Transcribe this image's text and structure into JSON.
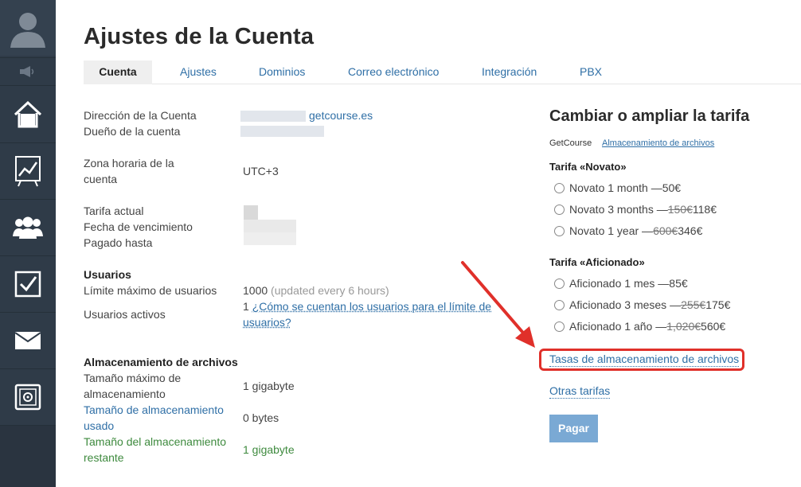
{
  "sidebar": {
    "items": [
      {
        "icon": "home-icon"
      },
      {
        "icon": "chart-icon"
      },
      {
        "icon": "users-icon"
      },
      {
        "icon": "checkbox-icon"
      },
      {
        "icon": "mail-icon"
      },
      {
        "icon": "safe-icon"
      }
    ]
  },
  "header": {
    "title": "Ajustes de la Cuenta",
    "tabs": [
      "Cuenta",
      "Ajustes",
      "Dominios",
      "Correo electrónico",
      "Integración",
      "PBX"
    ]
  },
  "account": {
    "address_label": "Dirección de la Cuenta",
    "address_domain": "getcourse.es",
    "owner_label": "Dueño de la cuenta",
    "timezone_label_1": "Zona horaria de la",
    "timezone_label_2": "cuenta",
    "timezone_value": "UTC+3",
    "tariff_label": "Tarifa actual",
    "expiry_label": "Fecha de vencimiento",
    "paid_label": "Pagado hasta"
  },
  "users": {
    "heading": "Usuarios",
    "max_label": "Límite máximo de usuarios",
    "max_value": "1000",
    "max_note": "(updated every 6 hours)",
    "active_label": "Usuarios activos",
    "active_value": "1",
    "active_link_1": "¿Cómo se cuentan los usuarios para el límite de",
    "active_link_2": "usuarios?"
  },
  "storage": {
    "heading": "Almacenamiento de archivos",
    "max_label_1": "Tamaño máximo de",
    "max_label_2": "almacenamiento",
    "max_value": "1 gigabyte",
    "used_label_1": "Tamaño de almacenamiento",
    "used_label_2": "usado",
    "used_value": "0 bytes",
    "remaining_label_1": "Tamaño del almacenamiento",
    "remaining_label_2": "restante",
    "remaining_value": "1 gigabyte"
  },
  "tariffs": {
    "title": "Cambiar o ampliar la tarifa",
    "sub_getcourse": "GetCourse",
    "sub_storage": "Almacenamiento de archivos",
    "novato_heading": "Tarifa «Novato»",
    "novato": [
      {
        "label": "Novato 1 month — ",
        "old": "",
        "price": "50€"
      },
      {
        "label": "Novato 3 months — ",
        "old": "150€",
        "price": " 118€"
      },
      {
        "label": "Novato 1 year — ",
        "old": "600€",
        "price": " 346€"
      }
    ],
    "aficionado_heading": "Tarifa «Aficionado»",
    "aficionado": [
      {
        "label": "Aficionado 1 mes — ",
        "old": "",
        "price": "85€"
      },
      {
        "label": "Aficionado 3 meses — ",
        "old": "255€",
        "price": " 175€"
      },
      {
        "label": "Aficionado 1 año — ",
        "old": "1,020€",
        "price": " 560€"
      }
    ],
    "storage_rates_link": "Tasas de almacenamiento de archivos",
    "other_tariffs_link": "Otras tarifas",
    "pay_button": "Pagar"
  },
  "colors": {
    "sidebar": "#2f3b48",
    "link": "#2f6fa6",
    "green": "#3e8a3e",
    "highlight": "#e0302a",
    "button": "#7aa9d4"
  }
}
